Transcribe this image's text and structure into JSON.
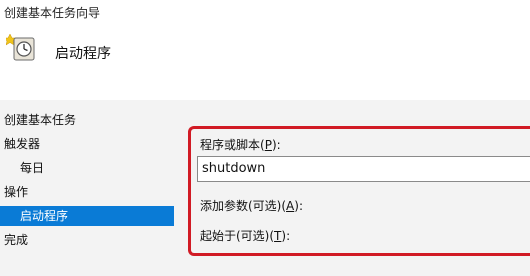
{
  "window": {
    "title": "创建基本任务向导"
  },
  "header": {
    "title": "启动程序",
    "icon": "task-clock-icon"
  },
  "sidebar": {
    "items": [
      {
        "label": "创建基本任务"
      },
      {
        "label": "触发器"
      },
      {
        "label": "每日"
      },
      {
        "label": "操作"
      },
      {
        "label": "启动程序",
        "selected": true
      },
      {
        "label": "完成"
      }
    ]
  },
  "form": {
    "program_label_pre": "程序或脚本(",
    "program_label_key": "P",
    "program_label_post": "):",
    "program_value": "shutdown",
    "args_label_pre": "添加参数(可选)(",
    "args_label_key": "A",
    "args_label_post": "):",
    "startin_label_pre": "起始于(可选)(",
    "startin_label_key": "T",
    "startin_label_post": "):"
  },
  "colors": {
    "selection": "#0a7bd6",
    "highlight_border": "#d11a24"
  }
}
